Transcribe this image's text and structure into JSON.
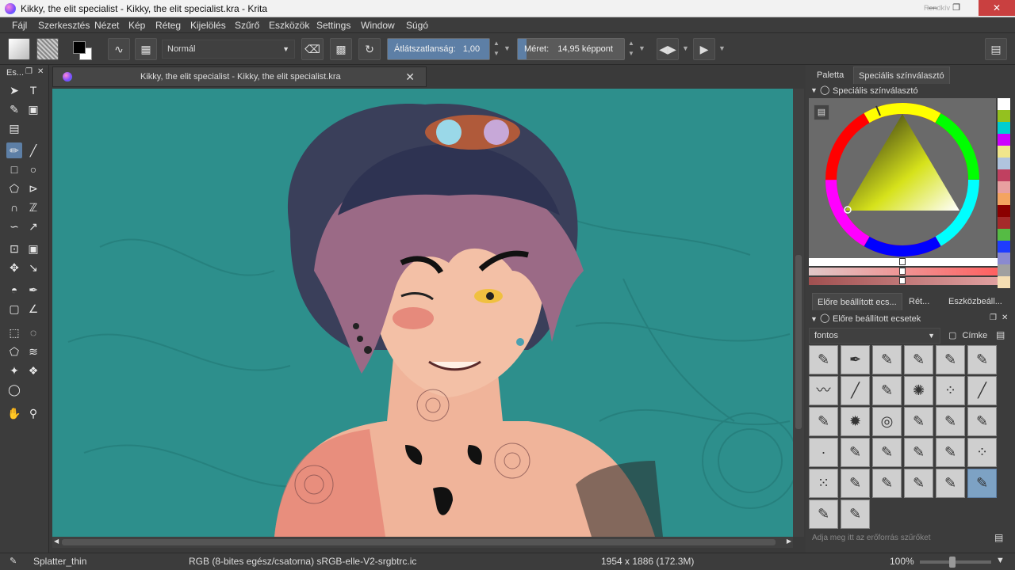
{
  "window": {
    "title": "Kikky, the elit specialist - Kikky, the elit specialist.kra  - Krita",
    "small_text": "Rendkív"
  },
  "menu": [
    "Fájl",
    "Szerkesztés",
    "Nézet",
    "Kép",
    "Réteg",
    "Kijelölés",
    "Szűrő",
    "Eszközök",
    "Settings",
    "Window",
    "Súgó"
  ],
  "toolbar": {
    "blend_mode": "Normál",
    "opacity_label": "Átlátszatlanság:",
    "opacity_value": "1,00",
    "opacity_fraction": 1.0,
    "size_label": "Méret:",
    "size_value": "14,95 képpont",
    "size_fraction": 0.08
  },
  "toolbox": {
    "header": "Es..."
  },
  "document": {
    "tab_title": "Kikky, the elit specialist - Kikky, the elit specialist.kra"
  },
  "right_panel": {
    "tabs": [
      "Paletta",
      "Speciális színválasztó"
    ],
    "color_dock_title": "Speciális színválasztó",
    "brush_tabs": [
      "Előre beállított ecs...",
      "Rét...",
      "Eszközbeáll..."
    ],
    "brush_dock_title": "Előre beállított ecsetek",
    "brush_tag": "fontos",
    "tag_button": "Címke",
    "search_placeholder": "Adja meg itt az erőforrás szűrőket"
  },
  "palette_colors": [
    "#ffffff",
    "#94c11f",
    "#00ced1",
    "#c0f",
    "#f0e68c",
    "#b0c4de",
    "#c04060",
    "#e8a0a0",
    "#f4a460",
    "#8b0000",
    "#a52a2a",
    "#5b4",
    "#1e3cff",
    "#8a8ad0",
    "#a0a0a0",
    "#f5deb3"
  ],
  "status": {
    "brush_name": "Splatter_thin",
    "color_space": "RGB (8-bites egész/csatorna)  sRGB-elle-V2-srgbtrc.ic",
    "dimensions": "1954 x 1886 (172.3M)",
    "zoom": "100%",
    "zoom_fraction": 0.45
  }
}
